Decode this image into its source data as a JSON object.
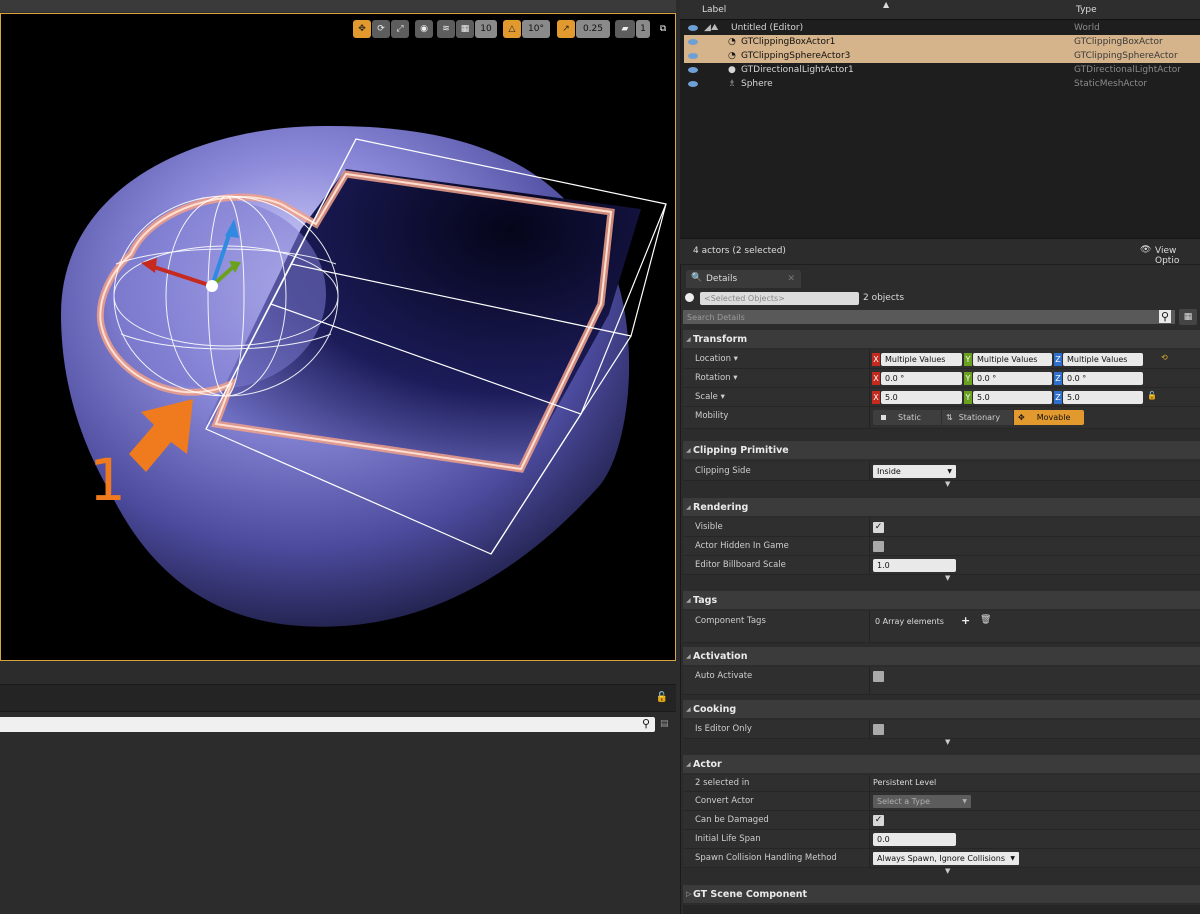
{
  "viewport": {
    "toolbar": {
      "grid_snap": "10",
      "rotation_snap": "10°",
      "scale_snap": "0.25",
      "camera_speed": "1"
    },
    "annotation_number": "1"
  },
  "outliner": {
    "col_label": "Label",
    "col_type": "Type",
    "rows": [
      {
        "label": "Untitled (Editor)",
        "type": "World",
        "selected": false
      },
      {
        "label": "GTClippingBoxActor1",
        "type": "GTClippingBoxActor",
        "selected": true
      },
      {
        "label": "GTClippingSphereActor3",
        "type": "GTClippingSphereActor",
        "selected": true
      },
      {
        "label": "GTDirectionalLightActor1",
        "type": "GTDirectionalLightActor",
        "selected": false
      },
      {
        "label": "Sphere",
        "type": "StaticMeshActor",
        "selected": false
      }
    ],
    "status": "4 actors (2 selected)",
    "view_options": "View Optio"
  },
  "details": {
    "tab_label": "Details",
    "selected_placeholder": "<Selected Objects>",
    "objects_count": "2 objects",
    "search_placeholder": "Search Details",
    "sections": {
      "transform": "Transform",
      "clipping": "Clipping Primitive",
      "rendering": "Rendering",
      "tags": "Tags",
      "activation": "Activation",
      "cooking": "Cooking",
      "actor": "Actor",
      "gt_scene": "GT Scene Component"
    },
    "transform": {
      "location_label": "Location",
      "location": [
        "Multiple Values",
        "Multiple Values",
        "Multiple Values"
      ],
      "rotation_label": "Rotation",
      "rotation": [
        "0.0 °",
        "0.0 °",
        "0.0 °"
      ],
      "scale_label": "Scale",
      "scale": [
        "5.0",
        "5.0",
        "5.0"
      ],
      "mobility_label": "Mobility",
      "mobility_options": [
        "Static",
        "Stationary",
        "Movable"
      ],
      "mobility_selected": "Movable"
    },
    "clipping": {
      "side_label": "Clipping Side",
      "side_value": "Inside"
    },
    "rendering": {
      "visible_label": "Visible",
      "hidden_label": "Actor Hidden In Game",
      "billboard_label": "Editor Billboard Scale",
      "billboard_value": "1.0"
    },
    "tags": {
      "component_tags_label": "Component Tags",
      "array_value": "0 Array elements"
    },
    "activation": {
      "auto_activate_label": "Auto Activate"
    },
    "cooking": {
      "editor_only_label": "Is Editor Only"
    },
    "actor": {
      "selected_in_label": "2 selected in",
      "selected_in_value": "Persistent Level",
      "convert_label": "Convert Actor",
      "convert_value": "Select a Type",
      "damaged_label": "Can be Damaged",
      "lifespan_label": "Initial Life Span",
      "lifespan_value": "0.0",
      "spawn_label": "Spawn Collision Handling Method",
      "spawn_value": "Always Spawn, Ignore Collisions"
    }
  },
  "colors": {
    "accent": "#e29a2f",
    "selection": "#d5b38b",
    "annotation": "#f07a1e"
  }
}
